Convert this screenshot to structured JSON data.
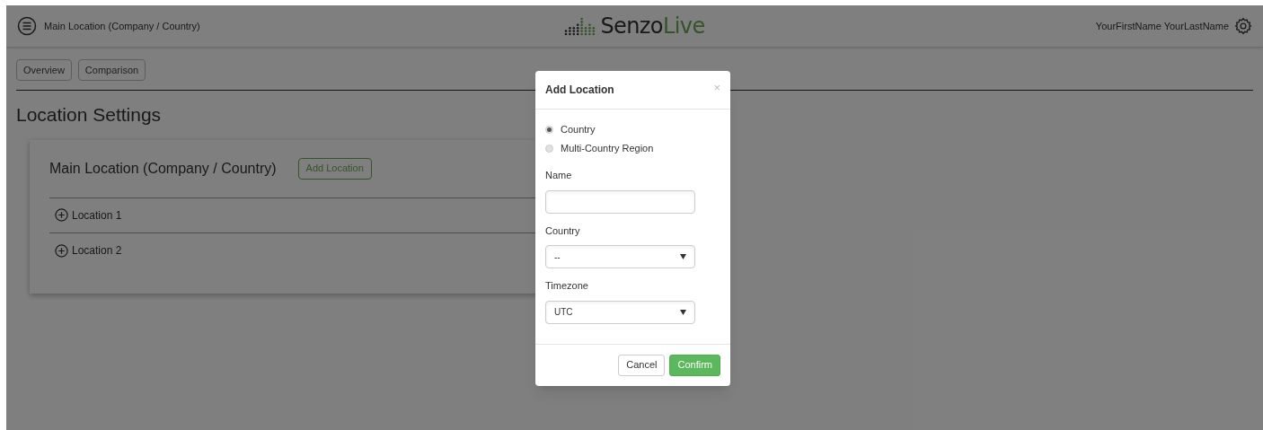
{
  "header": {
    "breadcrumb": "Main Location (Company / Country)",
    "logo": {
      "dark": "Senzo",
      "accent": "Live"
    },
    "user": "YourFirstName YourLastName"
  },
  "tabs": [
    {
      "label": "Overview",
      "selected": false
    },
    {
      "label": "Comparison",
      "selected": false
    }
  ],
  "page_title": "Location Settings",
  "card": {
    "title": "Main Location (Company / Country)",
    "add_button": "Add Location",
    "locations": [
      {
        "label": "Location 1",
        "expanded": false
      },
      {
        "label": "Location 2",
        "expanded": false
      }
    ]
  },
  "modal": {
    "title": "Add Location",
    "close": "×",
    "options": [
      {
        "label": "Country",
        "selected": true
      },
      {
        "label": "Multi-Country Region",
        "selected": false
      }
    ],
    "fields": [
      {
        "kind": "text",
        "label": "Name"
      },
      {
        "kind": "select",
        "label": "Country",
        "value": "--"
      },
      {
        "kind": "select",
        "label": "Timezone",
        "value": "UTC"
      }
    ],
    "buttons": [
      {
        "label": "Cancel",
        "kind": "default"
      },
      {
        "label": "Confirm",
        "kind": "primary"
      }
    ]
  }
}
